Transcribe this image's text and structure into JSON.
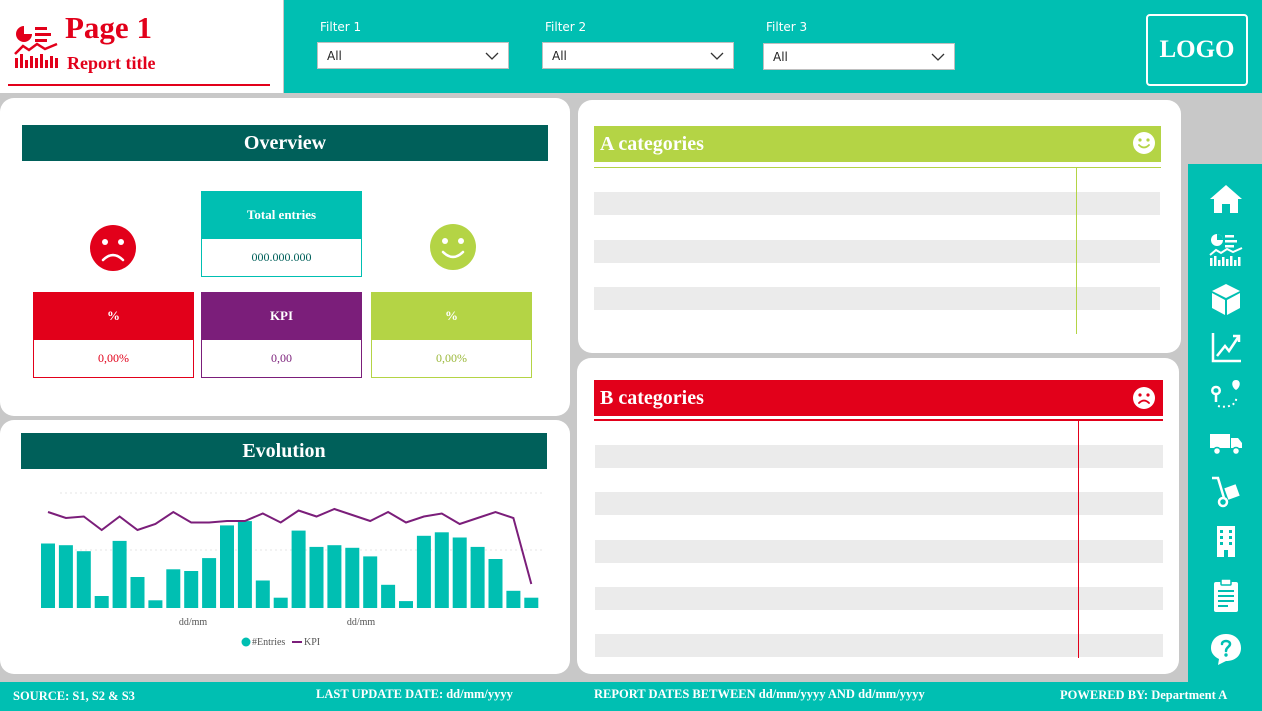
{
  "header": {
    "title": "Page 1",
    "subtitle": "Report title",
    "title_icon": "report-dashboard-icon",
    "logo": "LOGO"
  },
  "filters": [
    {
      "label": "Filter 1",
      "value": "All"
    },
    {
      "label": "Filter 2",
      "value": "All"
    },
    {
      "label": "Filter 3",
      "value": "All"
    }
  ],
  "overview": {
    "title": "Overview",
    "total": {
      "label": "Total entries",
      "value": "000.000.000"
    },
    "left": {
      "label": "%",
      "value": "0,00%",
      "icon": "sad-face-icon"
    },
    "kpi": {
      "label": "KPI",
      "value": "0,00"
    },
    "right": {
      "label": "%",
      "value": "0,00%",
      "icon": "happy-face-icon"
    }
  },
  "evolution": {
    "title": "Evolution",
    "legend_entries": "#Entries",
    "legend_kpi": "KPI"
  },
  "a_categories": {
    "title": "A categories",
    "icon": "happy-face-icon"
  },
  "b_categories": {
    "title": "B categories",
    "icon": "sad-face-icon"
  },
  "sidebar": {
    "icons": [
      "home-icon",
      "report-dashboard-icon",
      "box-icon",
      "line-chart-icon",
      "route-icon",
      "truck-icon",
      "hand-truck-icon",
      "building-icon",
      "clipboard-icon",
      "help-icon"
    ]
  },
  "footer": {
    "source": "SOURCE: S1, S2 & S3",
    "last_update": "LAST UPDATE DATE:  dd/mm/yyyy",
    "report_dates": "REPORT DATES BETWEEN dd/mm/yyyy AND dd/mm/yyyy",
    "powered_by": "POWERED BY: Department A"
  },
  "colors": {
    "teal": "#00bfb2",
    "dark_teal": "#00605a",
    "red": "#e2001a",
    "purple": "#7b1e7a",
    "green": "#b4d445"
  },
  "chart_data": {
    "type": "bar",
    "x_tick_labels": [
      "dd/mm",
      "dd/mm"
    ],
    "legend": [
      "#Entries",
      "KPI"
    ],
    "series": [
      {
        "name": "#Entries",
        "type": "bar",
        "values": [
          75,
          73,
          66,
          14,
          78,
          36,
          9,
          45,
          43,
          58,
          96,
          101,
          32,
          12,
          90,
          71,
          73,
          70,
          60,
          27,
          8,
          84,
          88,
          82,
          71,
          57,
          20,
          12
        ]
      },
      {
        "name": "KPI",
        "type": "line",
        "values": [
          0.52,
          0.48,
          0.49,
          0.4,
          0.49,
          0.4,
          0.44,
          0.52,
          0.45,
          0.45,
          0.46,
          0.46,
          0.51,
          0.45,
          0.53,
          0.49,
          0.54,
          0.5,
          0.46,
          0.52,
          0.45,
          0.49,
          0.51,
          0.44,
          0.48,
          0.52,
          0.48,
          0.04
        ]
      }
    ]
  }
}
